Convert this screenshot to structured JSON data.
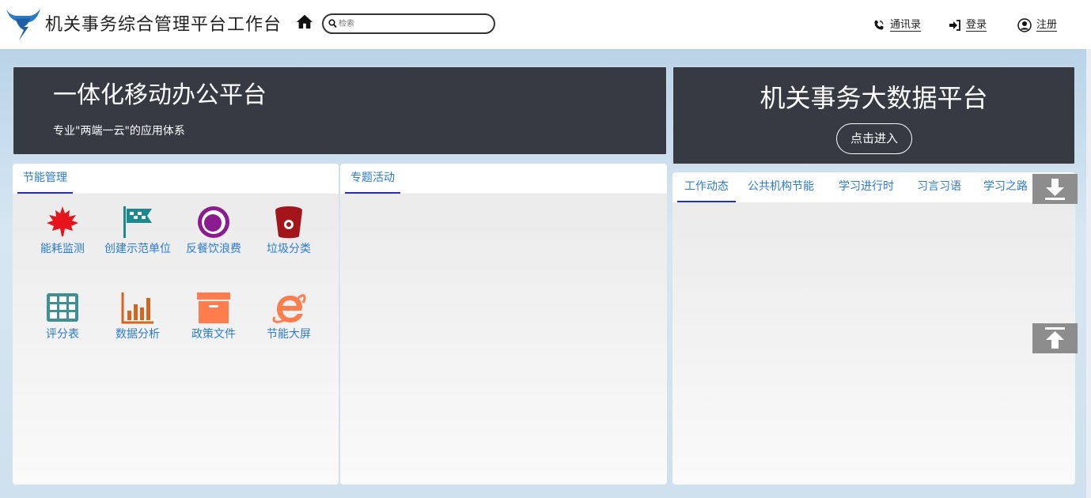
{
  "header": {
    "title": "机关事务综合管理平台工作台",
    "search_placeholder": "检索",
    "nav": [
      {
        "label": "通讯录",
        "icon": "phone-icon"
      },
      {
        "label": "登录",
        "icon": "sign-in-icon"
      },
      {
        "label": "注册",
        "icon": "user-icon"
      }
    ]
  },
  "banner_left": {
    "title": "一体化移动办公平台",
    "subtitle": "专业\"两端一云\"的应用体系"
  },
  "banner_right": {
    "title": "机关事务大数据平台",
    "button": "点击进入"
  },
  "energy_panel": {
    "tab": "节能管理",
    "items": [
      {
        "label": "能耗监测",
        "icon": "maple-leaf-icon",
        "color": "#e8141b"
      },
      {
        "label": "创建示范单位",
        "icon": "flags-icon",
        "color": "#1b8a8f"
      },
      {
        "label": "反餐饮浪费",
        "icon": "plate-icon",
        "color": "#8b1b8f"
      },
      {
        "label": "垃圾分类",
        "icon": "trash-bin-icon",
        "color": "#a3141b"
      },
      {
        "label": "评分表",
        "icon": "table-grid-icon",
        "color": "#3f8f93"
      },
      {
        "label": "数据分析",
        "icon": "bar-chart-icon",
        "color": "#d6641f"
      },
      {
        "label": "政策文件",
        "icon": "archive-box-icon",
        "color": "#ff7d4d"
      },
      {
        "label": "节能大屏",
        "icon": "ie-browser-icon",
        "color": "#ff7d4d"
      }
    ]
  },
  "activity_panel": {
    "tab": "专题活动"
  },
  "news_panel": {
    "tabs": [
      "工作动态",
      "公共机构节能",
      "学习进行时",
      "习言习语",
      "学习之路"
    ]
  },
  "floating": {
    "download_icon": "download-arrow-icon",
    "top_icon": "back-to-top-icon"
  },
  "colors": {
    "banner_bg": "#363b43",
    "tab_text": "#2b7bd1",
    "tab_underline": "#1f2bd8"
  }
}
